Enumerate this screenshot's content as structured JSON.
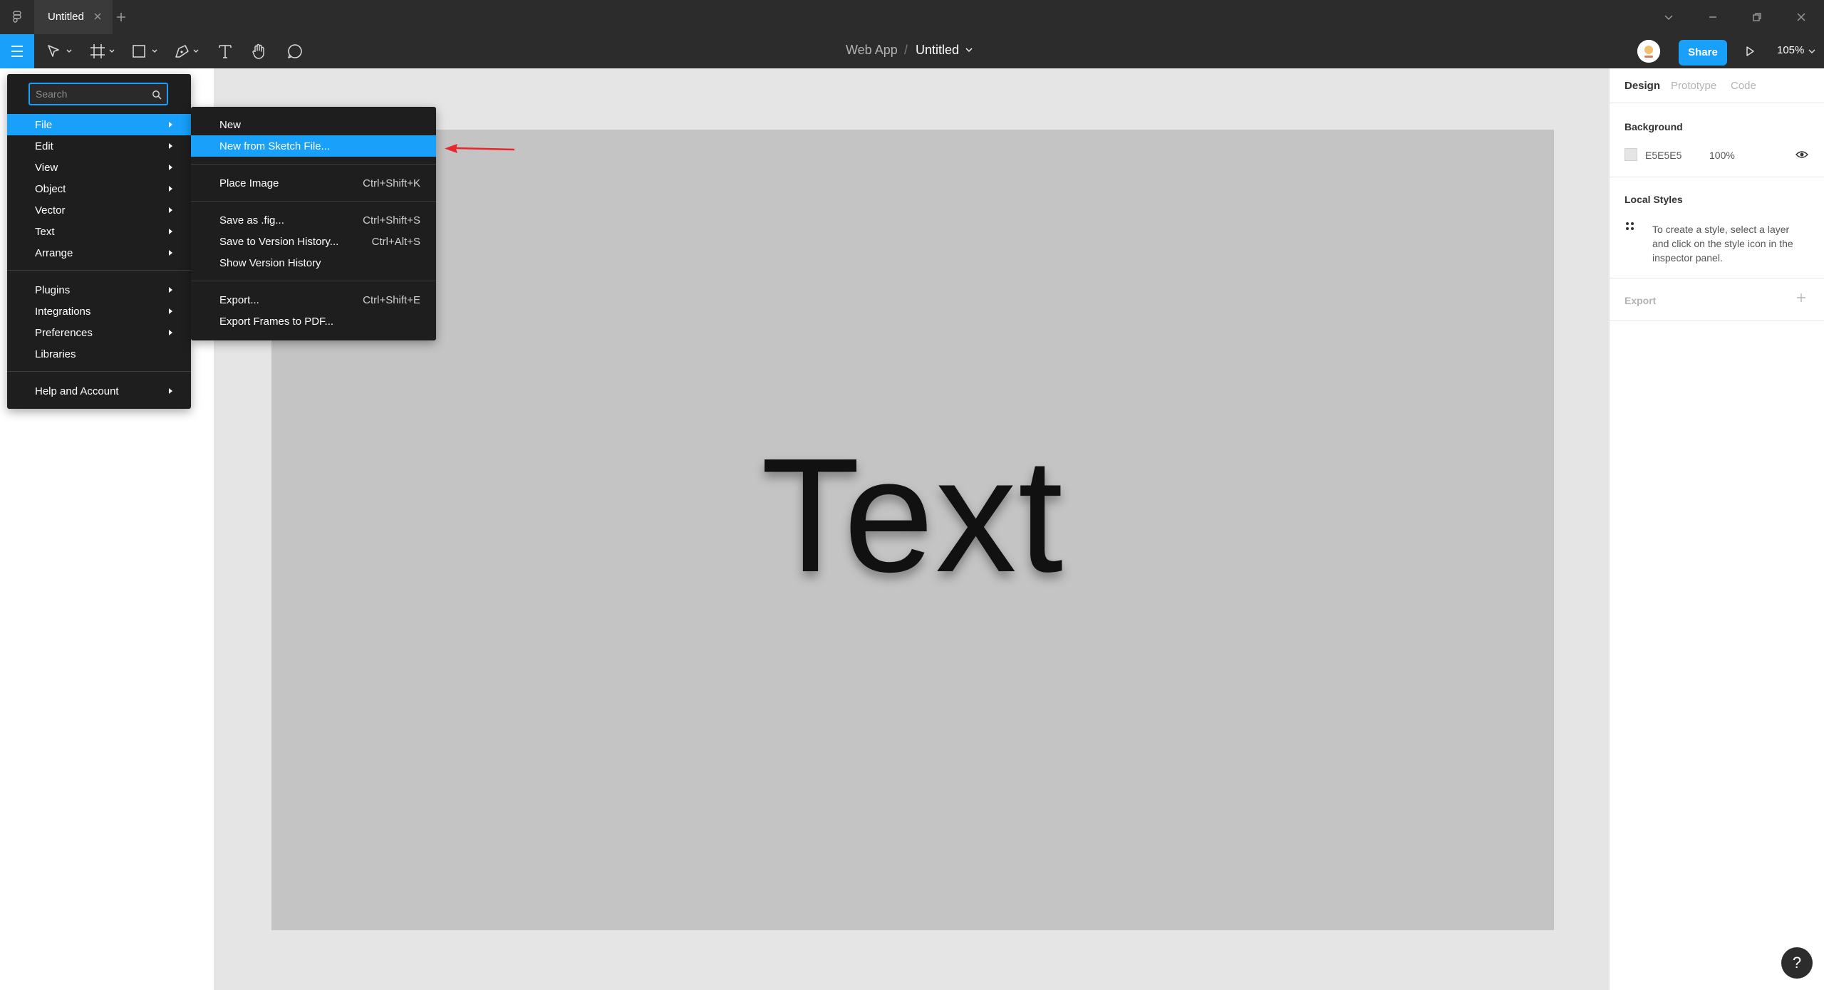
{
  "window": {
    "tab_title": "Untitled",
    "new_tab_symbol": "+"
  },
  "toolbar": {
    "breadcrumb_team": "Web App",
    "breadcrumb_sep": "/",
    "file_name": "Untitled",
    "share_label": "Share",
    "zoom": "105%"
  },
  "search": {
    "placeholder": "Search"
  },
  "main_menu": [
    {
      "label": "File",
      "has_submenu": true,
      "active": true
    },
    {
      "label": "Edit",
      "has_submenu": true
    },
    {
      "label": "View",
      "has_submenu": true
    },
    {
      "label": "Object",
      "has_submenu": true
    },
    {
      "label": "Vector",
      "has_submenu": true
    },
    {
      "label": "Text",
      "has_submenu": true
    },
    {
      "label": "Arrange",
      "has_submenu": true
    },
    {
      "label": "Plugins",
      "has_submenu": true
    },
    {
      "label": "Integrations",
      "has_submenu": true
    },
    {
      "label": "Preferences",
      "has_submenu": true
    },
    {
      "label": "Libraries",
      "has_submenu": false
    },
    {
      "label": "Help and Account",
      "has_submenu": true
    }
  ],
  "file_menu": [
    {
      "label": "New",
      "shortcut": ""
    },
    {
      "label": "New from Sketch File...",
      "shortcut": "",
      "active": true
    },
    {
      "label": "Place Image",
      "shortcut": "Ctrl+Shift+K"
    },
    {
      "label": "Save as .fig...",
      "shortcut": "Ctrl+Shift+S"
    },
    {
      "label": "Save to Version History...",
      "shortcut": "Ctrl+Alt+S"
    },
    {
      "label": "Show Version History",
      "shortcut": ""
    },
    {
      "label": "Export...",
      "shortcut": "Ctrl+Shift+E"
    },
    {
      "label": "Export Frames to PDF...",
      "shortcut": ""
    }
  ],
  "canvas": {
    "text": "Text"
  },
  "right_panel": {
    "tabs": [
      "Design",
      "Prototype",
      "Code"
    ],
    "background_heading": "Background",
    "background_hex": "E5E5E5",
    "background_opacity": "100%",
    "local_styles_heading": "Local Styles",
    "local_styles_hint": [
      "To create a style, select a layer",
      "and click on the style icon in the",
      "inspector panel."
    ],
    "export_heading": "Export",
    "export_add": "+"
  },
  "help": {
    "label": "?"
  },
  "colors": {
    "accent": "#18a0fb",
    "toolbar": "#2c2c2c",
    "menu": "#1e1e1e",
    "annotation_arrow": "#e8262c"
  }
}
